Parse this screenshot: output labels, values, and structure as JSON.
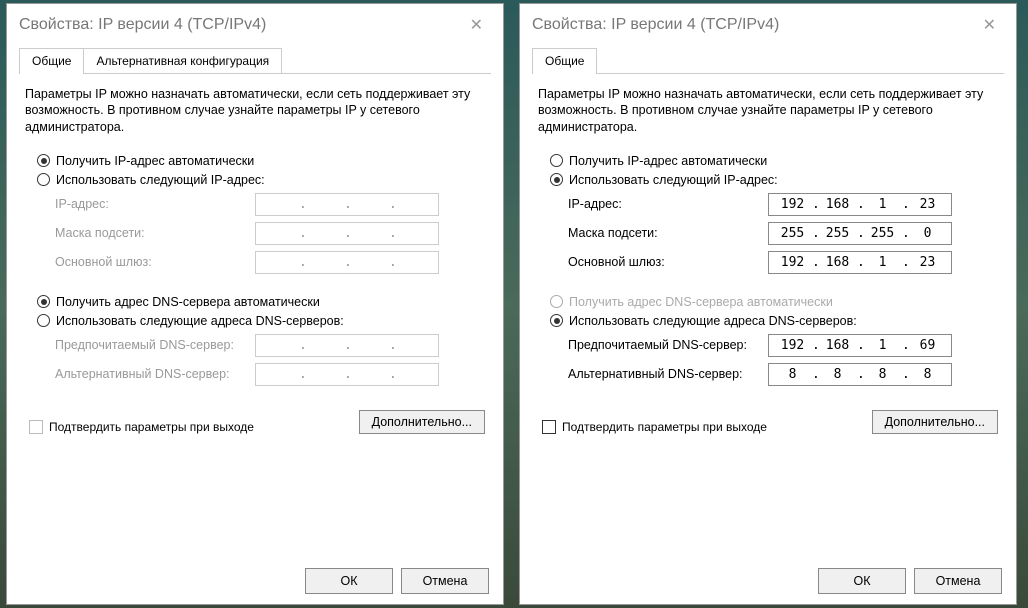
{
  "left": {
    "title": "Свойства: IP версии 4 (TCP/IPv4)",
    "tabs": {
      "general": "Общие",
      "alt": "Альтернативная конфигурация"
    },
    "intro": "Параметры IP можно назначать автоматически, если сеть поддерживает эту возможность. В противном случае узнайте параметры IP у сетевого администратора.",
    "ip": {
      "auto": "Получить IP-адрес автоматически",
      "manual": "Использовать следующий IP-адрес:",
      "addrLabel": "IP-адрес:",
      "maskLabel": "Маска подсети:",
      "gwLabel": "Основной шлюз:",
      "autoSelected": true,
      "addr": [
        "",
        "",
        "",
        ""
      ],
      "mask": [
        "",
        "",
        "",
        ""
      ],
      "gw": [
        "",
        "",
        "",
        ""
      ]
    },
    "dns": {
      "auto": "Получить адрес DNS-сервера автоматически",
      "manual": "Использовать следующие адреса DNS-серверов:",
      "prefLabel": "Предпочитаемый DNS-сервер:",
      "altLabel": "Альтернативный DNS-сервер:",
      "autoSelected": true,
      "pref": [
        "",
        "",
        "",
        ""
      ],
      "alt": [
        "",
        "",
        "",
        ""
      ]
    },
    "validate": "Подтвердить параметры при выходе",
    "advanced": "Дополнительно...",
    "ok": "ОК",
    "cancel": "Отмена"
  },
  "right": {
    "title": "Свойства: IP версии 4 (TCP/IPv4)",
    "tabs": {
      "general": "Общие"
    },
    "intro": "Параметры IP можно назначать автоматически, если сеть поддерживает эту возможность. В противном случае узнайте параметры IP у сетевого администратора.",
    "ip": {
      "auto": "Получить IP-адрес автоматически",
      "manual": "Использовать следующий IP-адрес:",
      "addrLabel": "IP-адрес:",
      "maskLabel": "Маска подсети:",
      "gwLabel": "Основной шлюз:",
      "autoSelected": false,
      "addr": [
        "192",
        "168",
        "1",
        "23"
      ],
      "mask": [
        "255",
        "255",
        "255",
        "0"
      ],
      "gw": [
        "192",
        "168",
        "1",
        "23"
      ]
    },
    "dns": {
      "auto": "Получить адрес DNS-сервера автоматически",
      "manual": "Использовать следующие адреса DNS-серверов:",
      "prefLabel": "Предпочитаемый DNS-сервер:",
      "altLabel": "Альтернативный DNS-сервер:",
      "autoSelected": false,
      "pref": [
        "192",
        "168",
        "1",
        "69"
      ],
      "alt": [
        "8",
        "8",
        "8",
        "8"
      ]
    },
    "validate": "Подтвердить параметры при выходе",
    "advanced": "Дополнительно...",
    "ok": "ОК",
    "cancel": "Отмена"
  }
}
